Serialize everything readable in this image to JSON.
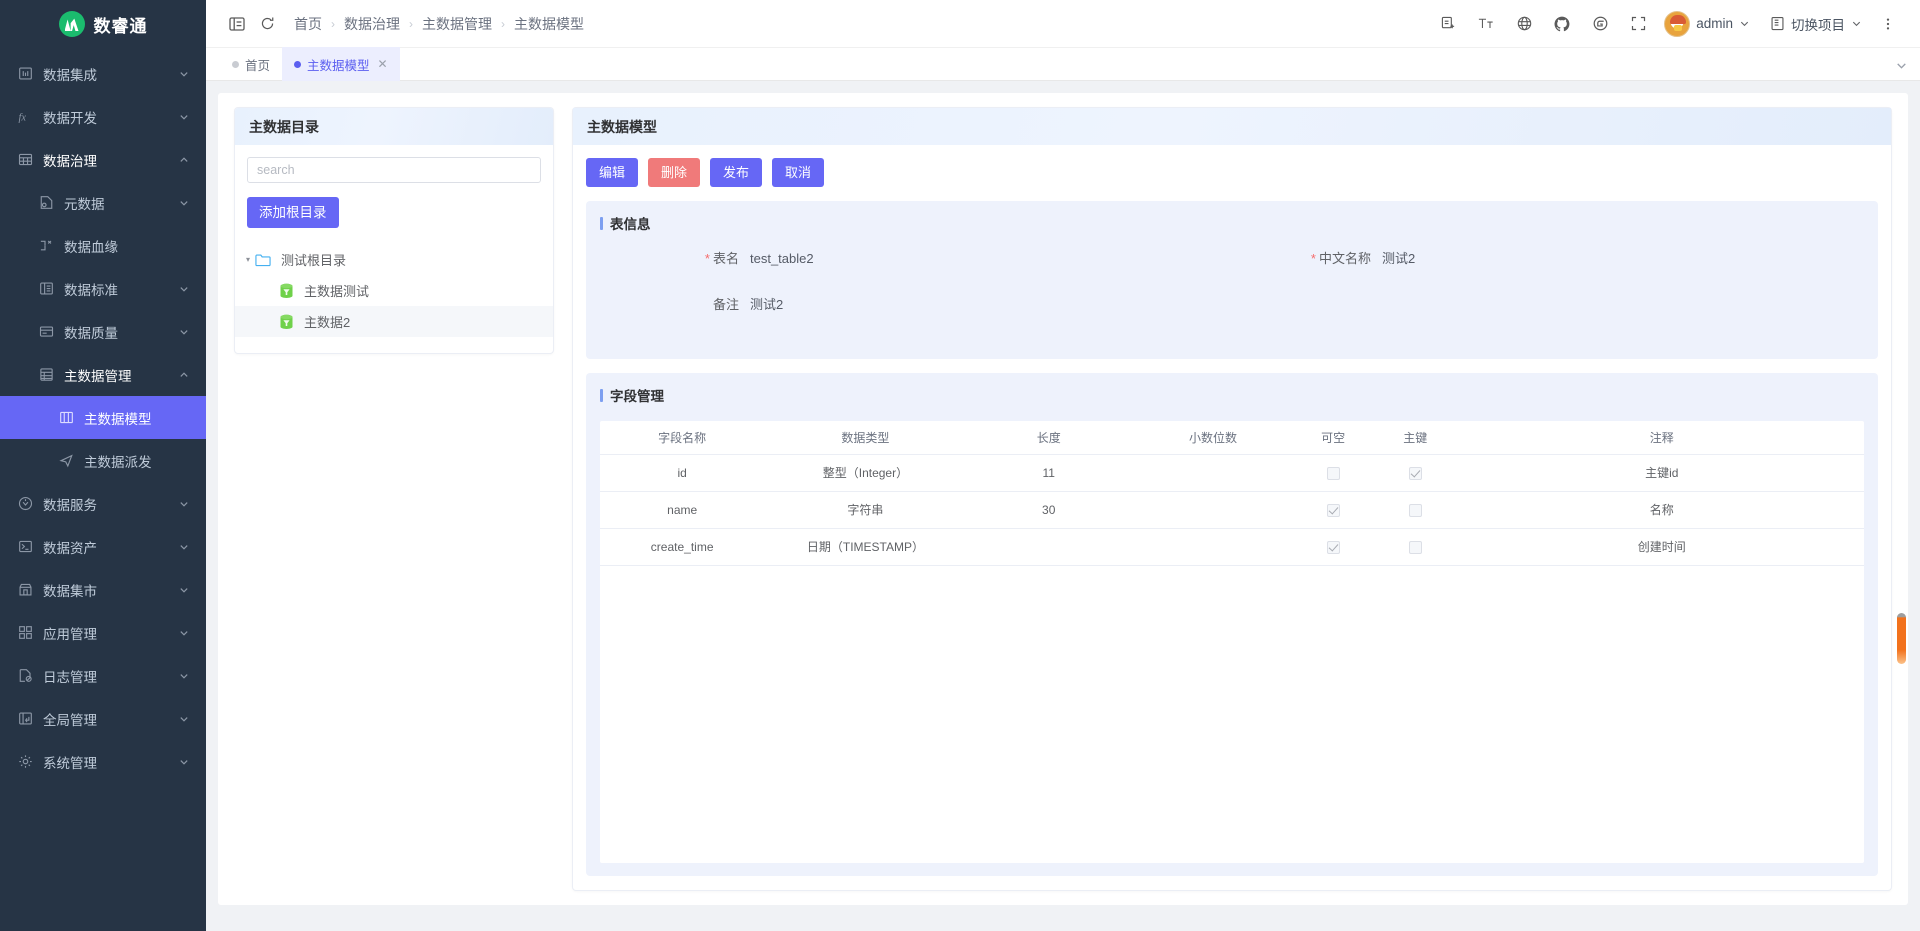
{
  "brand": {
    "name": "数睿通"
  },
  "sidebar": {
    "items": [
      {
        "label": "数据集成",
        "icon": "integration-icon",
        "level": 1,
        "expandable": true,
        "state": "normal"
      },
      {
        "label": "数据开发",
        "icon": "fx-icon",
        "level": 1,
        "expandable": true,
        "state": "normal"
      },
      {
        "label": "数据治理",
        "icon": "governance-icon",
        "level": 1,
        "expandable": true,
        "state": "expanded"
      },
      {
        "label": "元数据",
        "icon": "metadata-icon",
        "level": 2,
        "expandable": true,
        "state": "normal"
      },
      {
        "label": "数据血缘",
        "icon": "lineage-icon",
        "level": 2,
        "expandable": false,
        "state": "normal"
      },
      {
        "label": "数据标准",
        "icon": "standard-icon",
        "level": 2,
        "expandable": true,
        "state": "normal"
      },
      {
        "label": "数据质量",
        "icon": "quality-icon",
        "level": 2,
        "expandable": true,
        "state": "normal"
      },
      {
        "label": "主数据管理",
        "icon": "masterdata-icon",
        "level": 2,
        "expandable": true,
        "state": "expanded"
      },
      {
        "label": "主数据模型",
        "icon": "model-icon",
        "level": 3,
        "expandable": false,
        "state": "selected"
      },
      {
        "label": "主数据派发",
        "icon": "dispatch-icon",
        "level": 3,
        "expandable": false,
        "state": "normal"
      },
      {
        "label": "数据服务",
        "icon": "service-icon",
        "level": 1,
        "expandable": true,
        "state": "normal"
      },
      {
        "label": "数据资产",
        "icon": "asset-icon",
        "level": 1,
        "expandable": true,
        "state": "normal"
      },
      {
        "label": "数据集市",
        "icon": "market-icon",
        "level": 1,
        "expandable": true,
        "state": "normal"
      },
      {
        "label": "应用管理",
        "icon": "app-icon",
        "level": 1,
        "expandable": true,
        "state": "normal"
      },
      {
        "label": "日志管理",
        "icon": "log-icon",
        "level": 1,
        "expandable": true,
        "state": "normal"
      },
      {
        "label": "全局管理",
        "icon": "global-icon",
        "level": 1,
        "expandable": true,
        "state": "normal"
      },
      {
        "label": "系统管理",
        "icon": "system-icon",
        "level": 1,
        "expandable": true,
        "state": "normal"
      }
    ]
  },
  "topbar": {
    "collapse_icon": "menu-collapse-icon",
    "refresh_icon": "refresh-icon",
    "breadcrumb": [
      "首页",
      "数据治理",
      "主数据管理",
      "主数据模型"
    ],
    "icons": [
      "screenshot-icon",
      "font-size-icon",
      "language-globe-icon",
      "github-icon",
      "gitee-icon",
      "fullscreen-icon"
    ],
    "user": "admin",
    "project_switch": "切换项目",
    "more_icon": "more-vertical-icon"
  },
  "tabs": [
    {
      "label": "首页",
      "active": false,
      "closable": false
    },
    {
      "label": "主数据模型",
      "active": true,
      "closable": true
    }
  ],
  "catalog": {
    "title": "主数据目录",
    "search_placeholder": "search",
    "search_value": "",
    "add_root_label": "添加根目录",
    "tree": [
      {
        "label": "测试根目录",
        "level": 0,
        "icon": "folder-icon",
        "expanded": true,
        "selected": false
      },
      {
        "label": "主数据测试",
        "level": 1,
        "icon": "database-icon",
        "expanded": false,
        "selected": false
      },
      {
        "label": "主数据2",
        "level": 1,
        "icon": "database-icon",
        "expanded": false,
        "selected": true
      }
    ]
  },
  "detail": {
    "title": "主数据模型",
    "buttons": [
      {
        "label": "编辑",
        "style": "primary"
      },
      {
        "label": "删除",
        "style": "danger"
      },
      {
        "label": "发布",
        "style": "primary"
      },
      {
        "label": "取消",
        "style": "primary"
      }
    ],
    "table_info": {
      "section_title": "表信息",
      "fields": [
        {
          "label": "表名",
          "value": "test_table2",
          "required": true
        },
        {
          "label": "中文名称",
          "value": "测试2",
          "required": true
        },
        {
          "label": "备注",
          "value": "测试2",
          "required": false
        }
      ]
    },
    "field_manage": {
      "section_title": "字段管理",
      "columns": [
        "字段名称",
        "数据类型",
        "长度",
        "小数位数",
        "可空",
        "主键",
        "注释"
      ],
      "rows": [
        {
          "name": "id",
          "type": "整型（Integer）",
          "length": "11",
          "scale": "",
          "nullable": false,
          "primary": true,
          "comment": "主键id"
        },
        {
          "name": "name",
          "type": "字符串",
          "length": "30",
          "scale": "",
          "nullable": true,
          "primary": false,
          "comment": "名称"
        },
        {
          "name": "create_time",
          "type": "日期（TIMESTAMP）",
          "length": "",
          "scale": "",
          "nullable": true,
          "primary": false,
          "comment": "创建时间"
        }
      ]
    }
  },
  "colors": {
    "accent": "#6667f5",
    "danger": "#f07a7a",
    "sidebar_bg": "#263445",
    "section_bg": "#eef2fc",
    "scrollbar": "#f2711c"
  }
}
